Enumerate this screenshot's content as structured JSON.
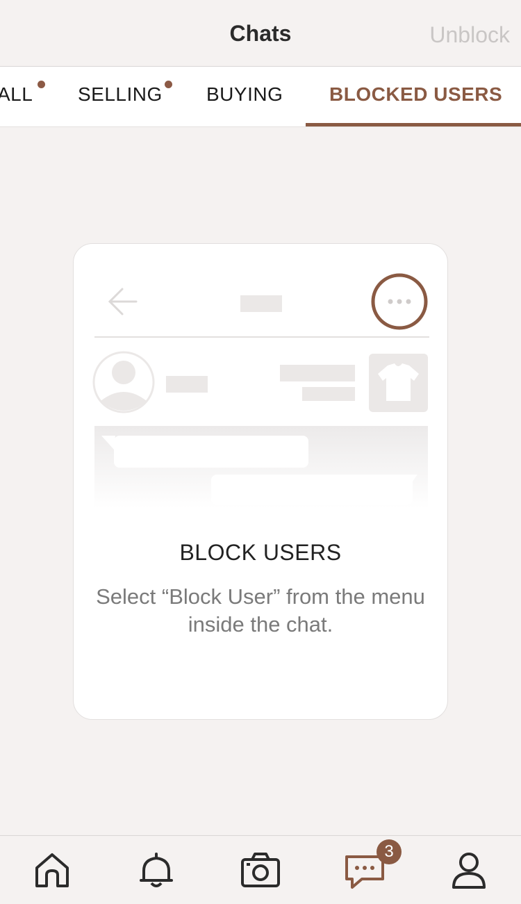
{
  "header": {
    "title": "Chats",
    "action_label": "Unblock"
  },
  "tabs": [
    {
      "label": "ALL",
      "has_dot": true
    },
    {
      "label": "SELLING",
      "has_dot": true
    },
    {
      "label": "BUYING",
      "has_dot": false
    },
    {
      "label": "BLOCKED USERS",
      "has_dot": false,
      "active": true
    }
  ],
  "empty_state": {
    "title": "BLOCK USERS",
    "description": "Select “Block User” from the menu inside the chat.",
    "illustration_icons": [
      "back-arrow-icon",
      "more-dots-icon",
      "avatar-icon",
      "tshirt-icon"
    ]
  },
  "bottom_nav": {
    "items": [
      {
        "icon": "home-icon"
      },
      {
        "icon": "bell-icon"
      },
      {
        "icon": "camera-icon"
      },
      {
        "icon": "chat-icon",
        "active": true
      },
      {
        "icon": "profile-icon"
      }
    ],
    "chat_badge": "3"
  },
  "colors": {
    "accent": "#8a5a43",
    "background": "#f5f2f1",
    "muted_text": "#7a7a7a"
  }
}
